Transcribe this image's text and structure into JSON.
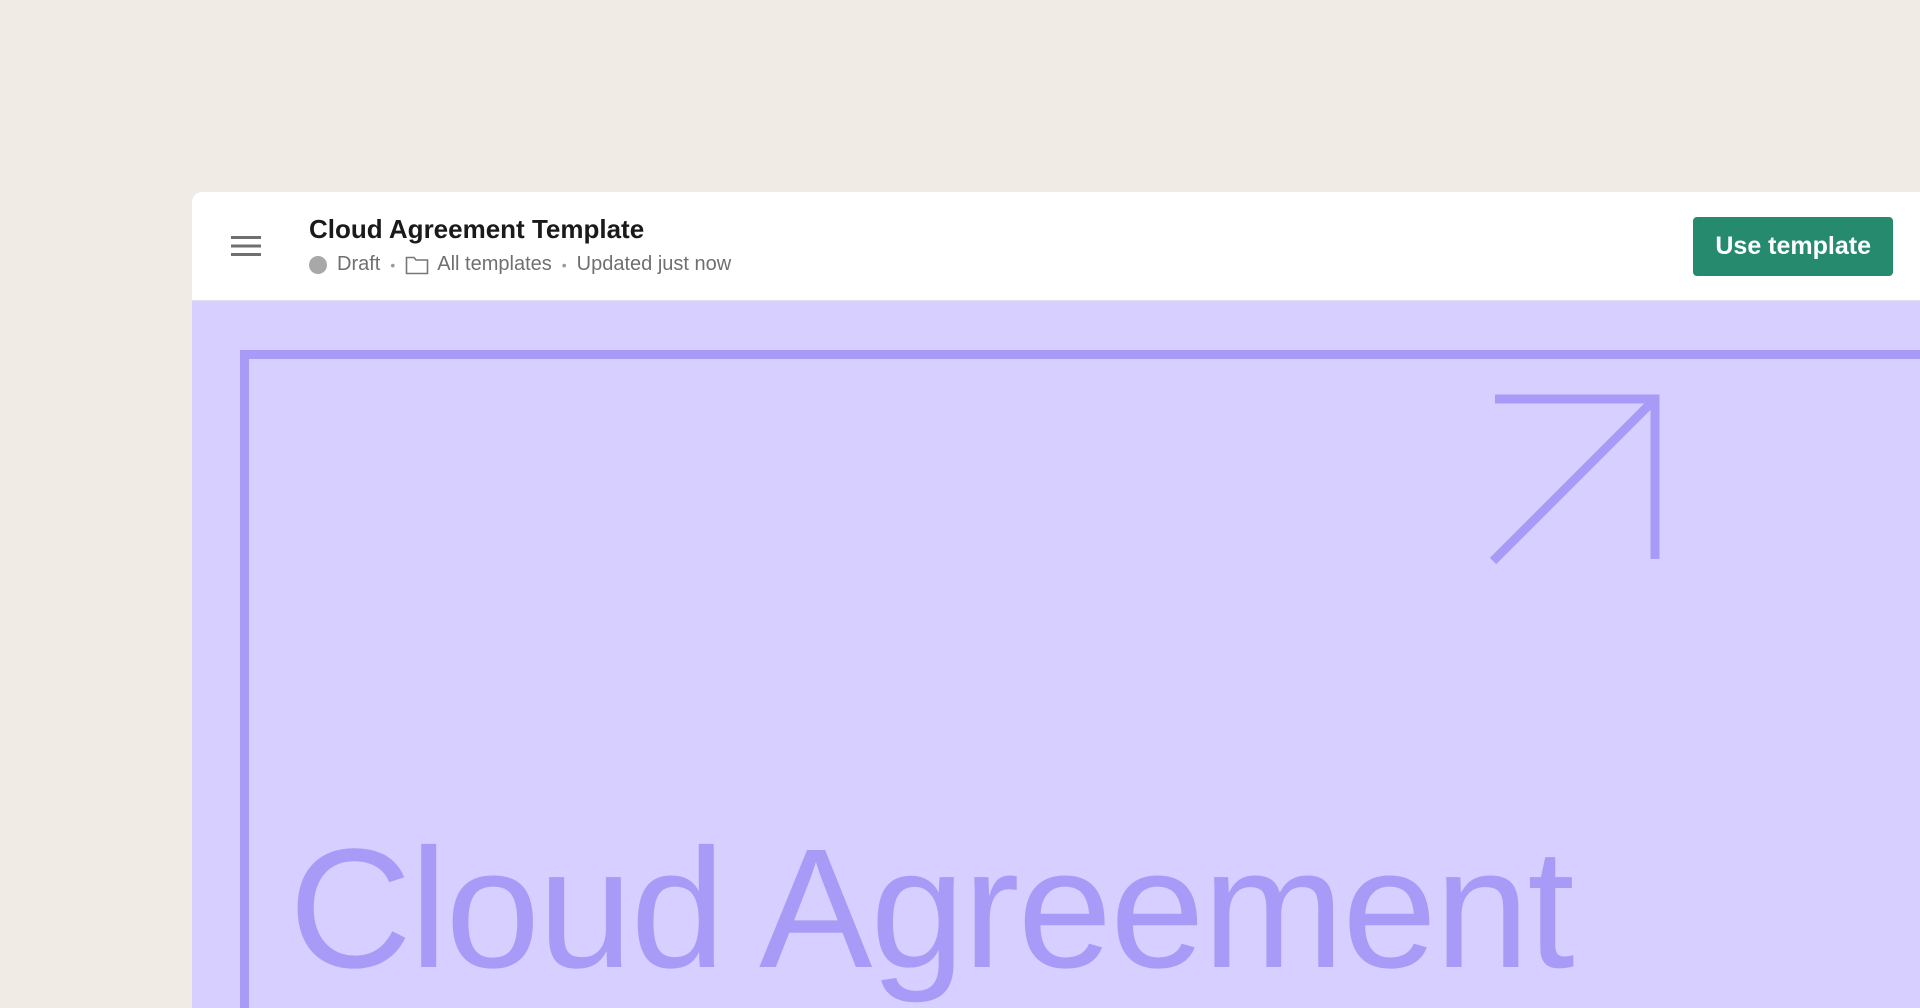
{
  "header": {
    "title": "Cloud Agreement Template",
    "status": "Draft",
    "folder": "All templates",
    "updated": "Updated just now",
    "separator": "•",
    "primary_action": "Use template"
  },
  "preview": {
    "title": "Cloud Agreement"
  },
  "icons": {
    "menu": "hamburger-menu-icon",
    "status": "status-dot-icon",
    "folder": "folder-icon",
    "arrow": "arrow-up-right-icon"
  },
  "colors": {
    "page_background": "#f0ebe5",
    "preview_background": "#d6cfff",
    "preview_accent": "#a79bf7",
    "primary_button": "#268a6e",
    "status_dot": "#a8a8a8"
  }
}
